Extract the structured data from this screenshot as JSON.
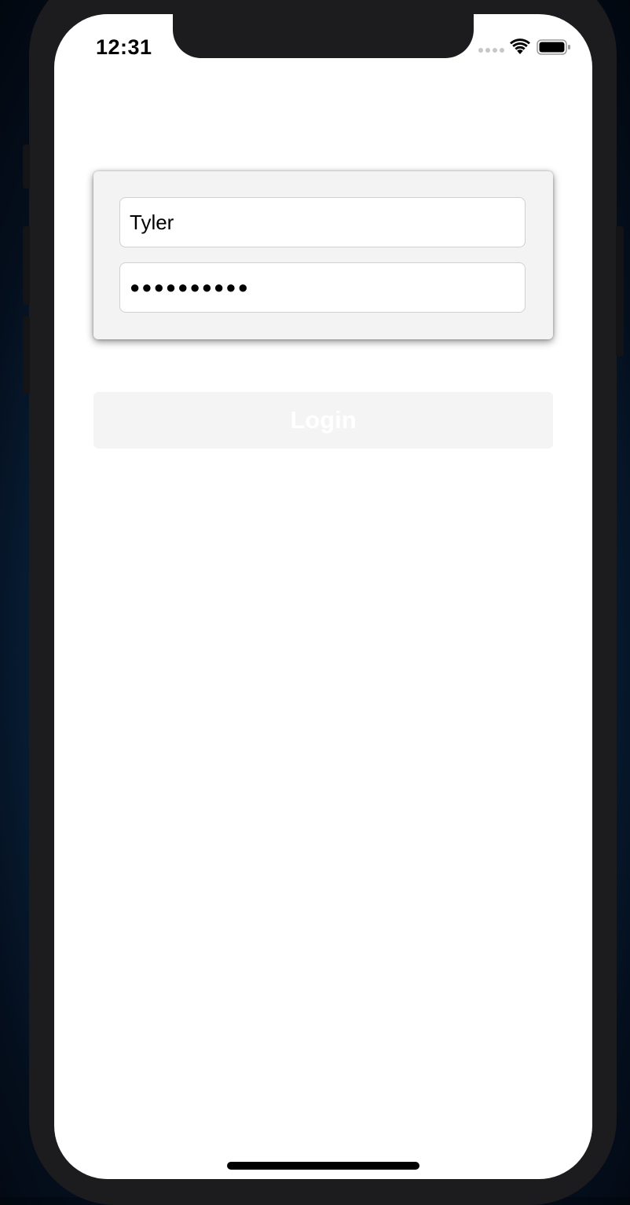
{
  "status_bar": {
    "time": "12:31",
    "signal_icon": "signal-dots-icon",
    "wifi_icon": "wifi-icon",
    "battery_icon": "battery-icon"
  },
  "login_form": {
    "username_value": "Tyler",
    "password_masked": "●●●●●●●●●●",
    "password_length": 10
  },
  "login_button": {
    "label": "Login"
  },
  "colors": {
    "card_background": "#f3f3f3",
    "button_background": "#f4f4f4",
    "button_text": "#ffffff",
    "screen_background": "#ffffff"
  }
}
